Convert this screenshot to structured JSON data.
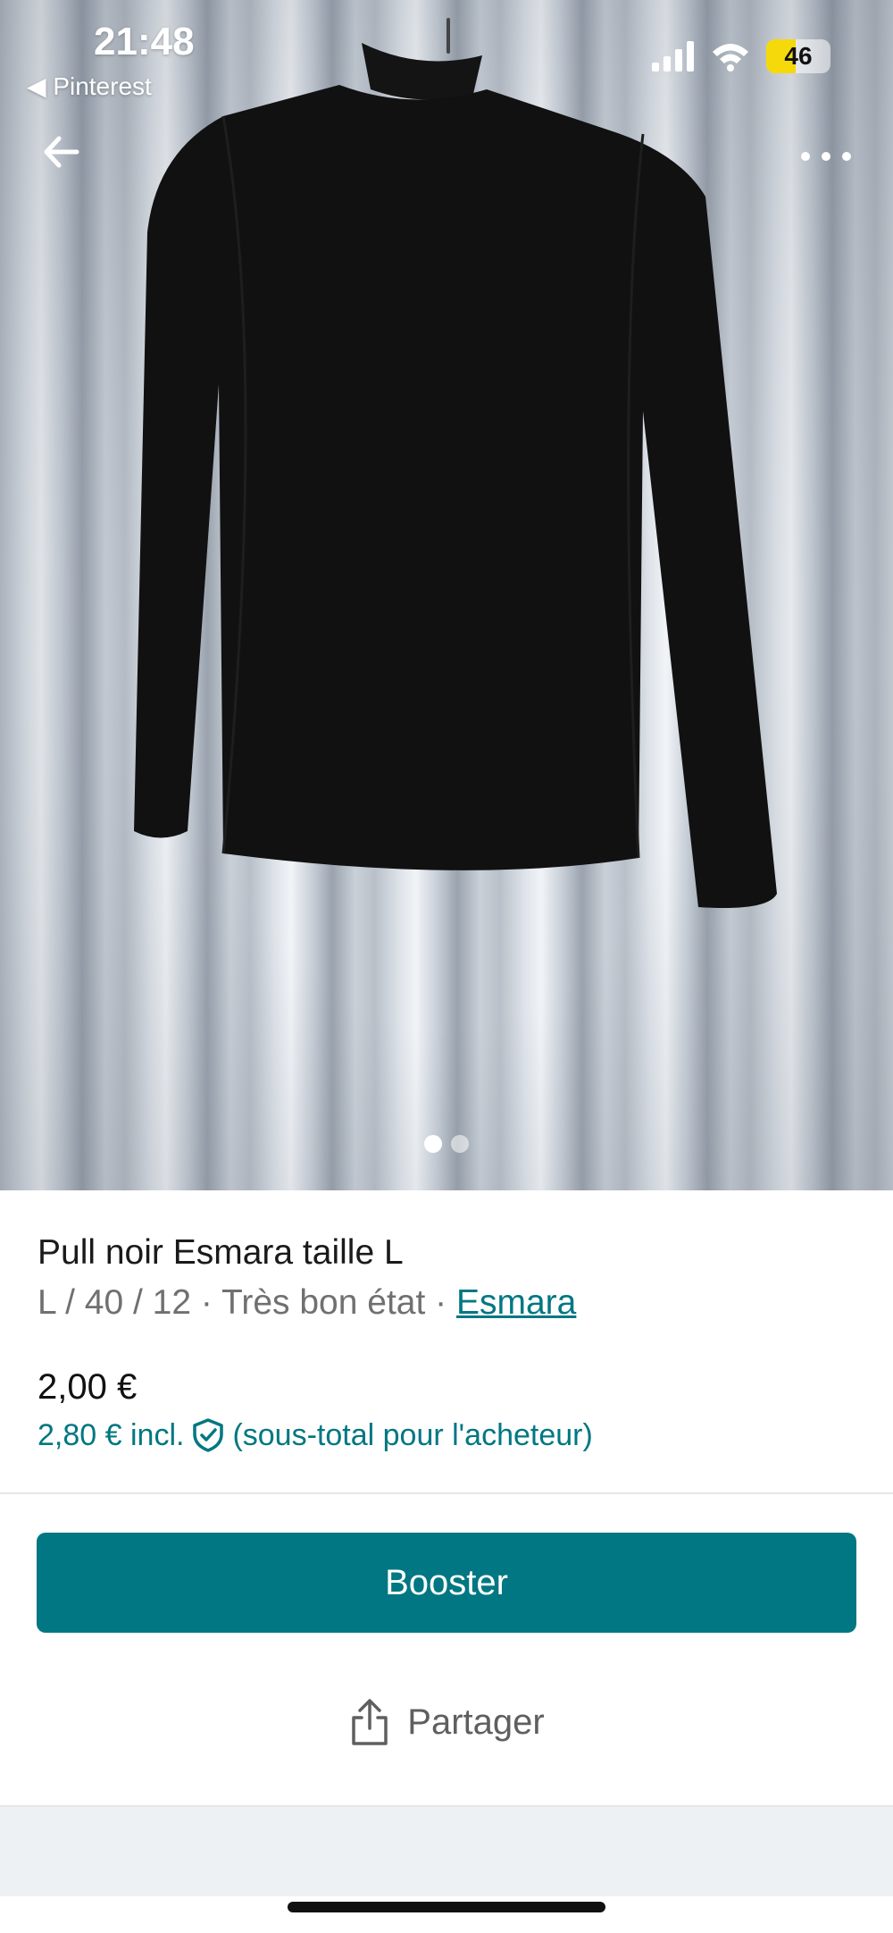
{
  "status_bar": {
    "time": "21:48",
    "back_app": "◀ Pinterest",
    "battery": "46",
    "battery_level": 0.46
  },
  "nav": {
    "back_icon": "arrow-left-icon",
    "more_icon": "more-horizontal-icon"
  },
  "gallery": {
    "total_images": 2,
    "active_index": 0
  },
  "item": {
    "title": "Pull noir Esmara taille L",
    "details": "L / 40 / 12 · Très bon état · ",
    "brand": "Esmara",
    "price": "2,00 €",
    "price_incl": "2,80 € incl.",
    "price_note": "(sous-total pour l'acheteur)"
  },
  "actions": {
    "boost_label": "Booster",
    "share_label": "Partager"
  },
  "colors": {
    "accent": "#007782",
    "battery_yellow": "#f5d90a"
  }
}
